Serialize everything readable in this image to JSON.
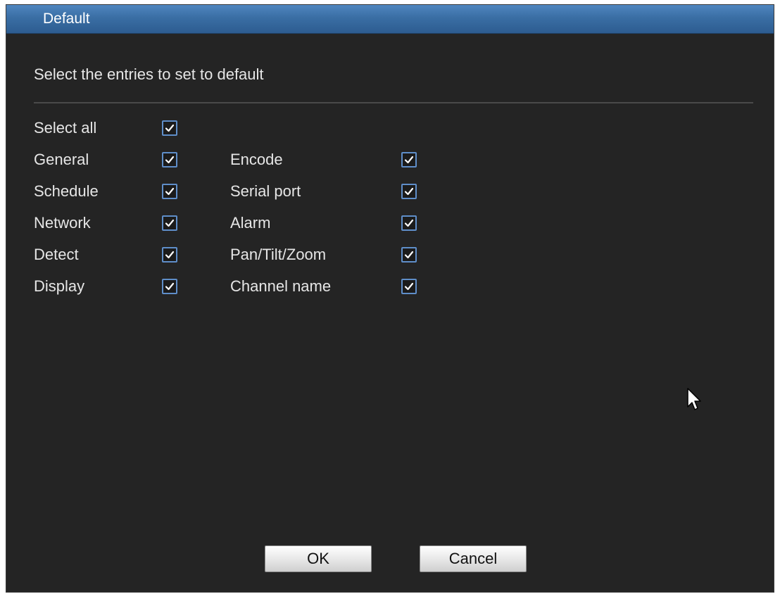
{
  "window": {
    "title": "Default"
  },
  "instruction": "Select the entries to set to default",
  "select_all": {
    "label": "Select all",
    "checked": true
  },
  "entries": {
    "general": {
      "label": "General",
      "checked": true
    },
    "schedule": {
      "label": "Schedule",
      "checked": true
    },
    "network": {
      "label": "Network",
      "checked": true
    },
    "detect": {
      "label": "Detect",
      "checked": true
    },
    "display": {
      "label": "Display",
      "checked": true
    },
    "encode": {
      "label": "Encode",
      "checked": true
    },
    "serial_port": {
      "label": "Serial port",
      "checked": true
    },
    "alarm": {
      "label": "Alarm",
      "checked": true
    },
    "pan_tilt_zoom": {
      "label": "Pan/Tilt/Zoom",
      "checked": true
    },
    "channel_name": {
      "label": "Channel name",
      "checked": true
    }
  },
  "buttons": {
    "ok": "OK",
    "cancel": "Cancel"
  },
  "colors": {
    "title_bar": "#3a6ea4",
    "background": "#242424",
    "checkbox_border": "#5f8ec9",
    "text": "#e6e6e6"
  },
  "icons": {
    "check": "check-icon",
    "cursor": "mouse-pointer-icon"
  }
}
